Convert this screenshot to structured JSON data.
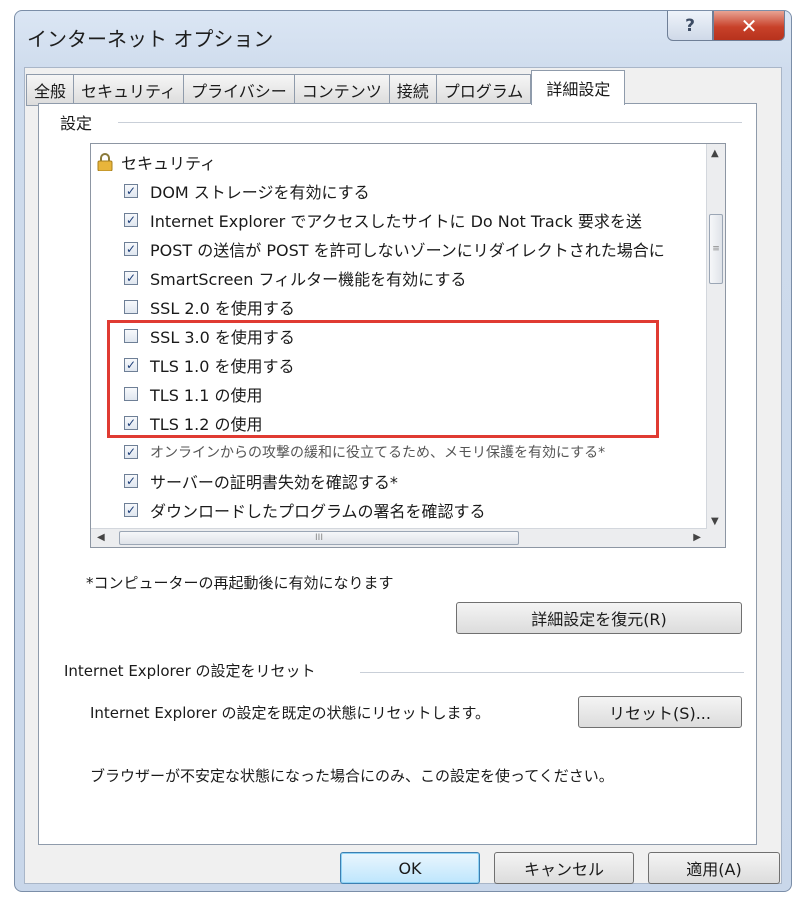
{
  "window": {
    "title": "インターネット オプション",
    "help_glyph": "?",
    "close_glyph": "✕"
  },
  "tabs": [
    {
      "label": "全般",
      "active": false
    },
    {
      "label": "セキュリティ",
      "active": false
    },
    {
      "label": "プライバシー",
      "active": false
    },
    {
      "label": "コンテンツ",
      "active": false
    },
    {
      "label": "接続",
      "active": false
    },
    {
      "label": "プログラム",
      "active": false
    },
    {
      "label": "詳細設定",
      "active": true
    }
  ],
  "settings": {
    "legend": "設定",
    "group_label": "セキュリティ",
    "items": [
      {
        "label": "DOM ストレージを有効にする",
        "checked": true
      },
      {
        "label": "Internet Explorer でアクセスしたサイトに Do Not Track 要求を送",
        "checked": true
      },
      {
        "label": "POST の送信が POST を許可しないゾーンにリダイレクトされた場合に",
        "checked": true
      },
      {
        "label": "SmartScreen フィルター機能を有効にする",
        "checked": true
      },
      {
        "label": "SSL 2.0 を使用する",
        "checked": false
      },
      {
        "label": "SSL 3.0 を使用する",
        "checked": false
      },
      {
        "label": "TLS 1.0 を使用する",
        "checked": true
      },
      {
        "label": "TLS 1.1 の使用",
        "checked": false
      },
      {
        "label": "TLS 1.2 の使用",
        "checked": true
      },
      {
        "label": "オンラインからの攻撃の緩和に役立てるため、メモリ保護を有効にする*",
        "checked": true
      },
      {
        "label": "サーバーの証明書失効を確認する*",
        "checked": true
      },
      {
        "label": "ダウンロードしたプログラムの署名を確認する",
        "checked": true
      }
    ],
    "restart_note": "*コンピューターの再起動後に有効になります",
    "restore_button": "詳細設定を復元(R)"
  },
  "reset": {
    "legend": "Internet Explorer の設定をリセット",
    "description": "Internet Explorer の設定を既定の状態にリセットします。",
    "button": "リセット(S)...",
    "warning": "ブラウザーが不安定な状態になった場合にのみ、この設定を使ってください。"
  },
  "footer": {
    "ok": "OK",
    "cancel": "キャンセル",
    "apply": "適用(A)"
  },
  "colors": {
    "highlight": "#e03b32",
    "check": "#1f3f78"
  },
  "icons": {
    "lock": "lock-icon",
    "checkmark": "✓",
    "scroll_up": "▲",
    "scroll_down": "▼",
    "scroll_left": "◀",
    "scroll_right": "▶",
    "grip_v": "≡",
    "grip_h": "III"
  }
}
